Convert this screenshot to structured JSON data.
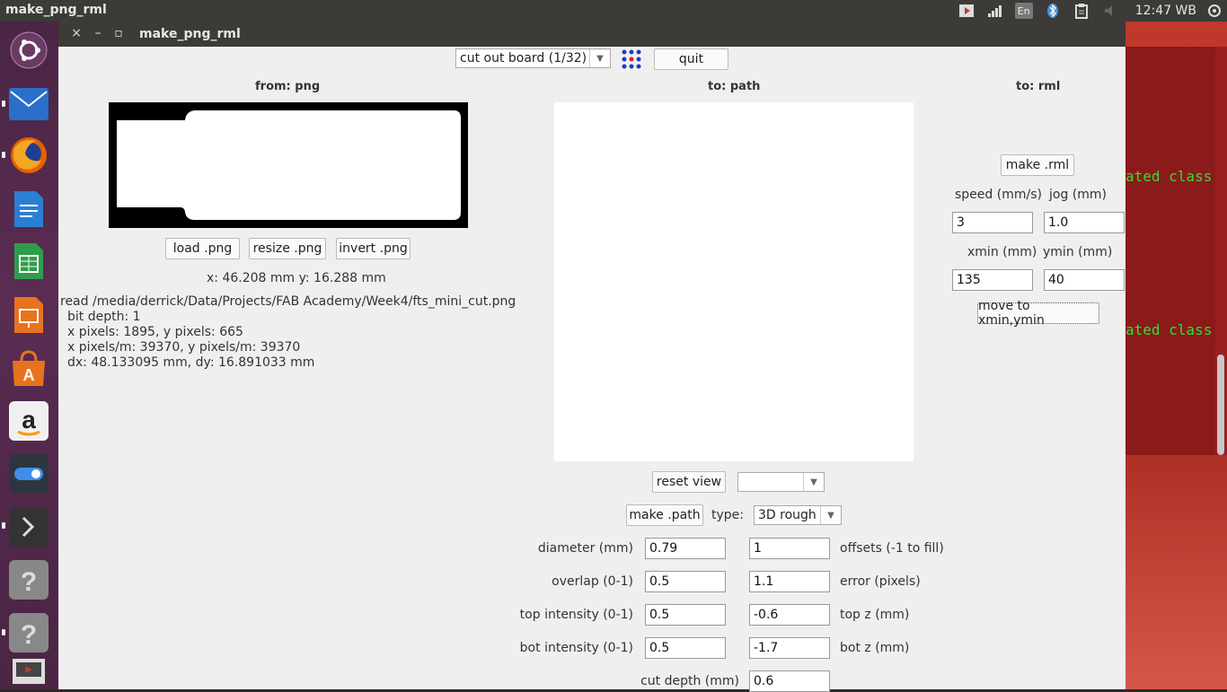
{
  "topbar": {
    "app_title": "make_png_rml",
    "clock": "12:47 WB",
    "lang": "En"
  },
  "launcher": {
    "items": [
      "ubuntu-dash-icon",
      "mail-icon",
      "firefox-icon",
      "writer-icon",
      "calc-icon",
      "impress-icon",
      "software-center-icon",
      "amazon-icon",
      "settings-toggle-icon",
      "terminal-icon",
      "unknown-app-icon",
      "unknown-app-icon",
      "screenshot-icon"
    ]
  },
  "window": {
    "title": "make_png_rml",
    "close": "×",
    "minimize": "–",
    "maximize": "▫"
  },
  "toolbar": {
    "mode_value": "cut out board (1/32)",
    "quit_label": "quit"
  },
  "from_png": {
    "header": "from: png",
    "load_label": "load .png",
    "resize_label": "resize .png",
    "invert_label": "invert .png",
    "coords": "x: 46.208 mm  y: 16.288 mm",
    "info": {
      "read": "read /media/derrick/Data/Projects/FAB Academy/Week4/fts_mini_cut.png",
      "bit_depth": "bit depth: 1",
      "pixels": "x pixels: 1895, y pixels: 665",
      "ppm": "x pixels/m: 39370, y pixels/m: 39370",
      "dims": "dx: 48.133095 mm, dy: 16.891033 mm"
    }
  },
  "to_path": {
    "header": "to: path",
    "reset_label": "reset view",
    "view_select": "",
    "make_path_label": "make .path",
    "type_label": "type:",
    "type_value": "3D rough",
    "fields": {
      "diameter_label": "diameter (mm)",
      "diameter": "0.79",
      "offsets_label": "offsets (-1 to fill)",
      "offsets": "1",
      "overlap_label": "overlap (0-1)",
      "overlap": "0.5",
      "error_label": "error (pixels)",
      "error": "1.1",
      "top_intensity_label": "top intensity (0-1)",
      "top_intensity": "0.5",
      "top_z_label": "top z (mm)",
      "top_z": "-0.6",
      "bot_intensity_label": "bot intensity (0-1)",
      "bot_intensity": "0.5",
      "bot_z_label": "bot z (mm)",
      "bot_z": "-1.7",
      "cut_depth_label": "cut depth (mm)",
      "cut_depth": "0.6"
    }
  },
  "to_rml": {
    "header": "to: rml",
    "make_rml_label": "make .rml",
    "speed_label": "speed (mm/s)",
    "speed": "3",
    "jog_label": "jog (mm)",
    "jog": "1.0",
    "xmin_label": "xmin (mm)",
    "xmin": "135",
    "ymin_label": "ymin (mm)",
    "ymin": "40",
    "move_label": "move to xmin,ymin"
  },
  "terminal": {
    "line1": "ated class",
    "line2": "ated class"
  }
}
